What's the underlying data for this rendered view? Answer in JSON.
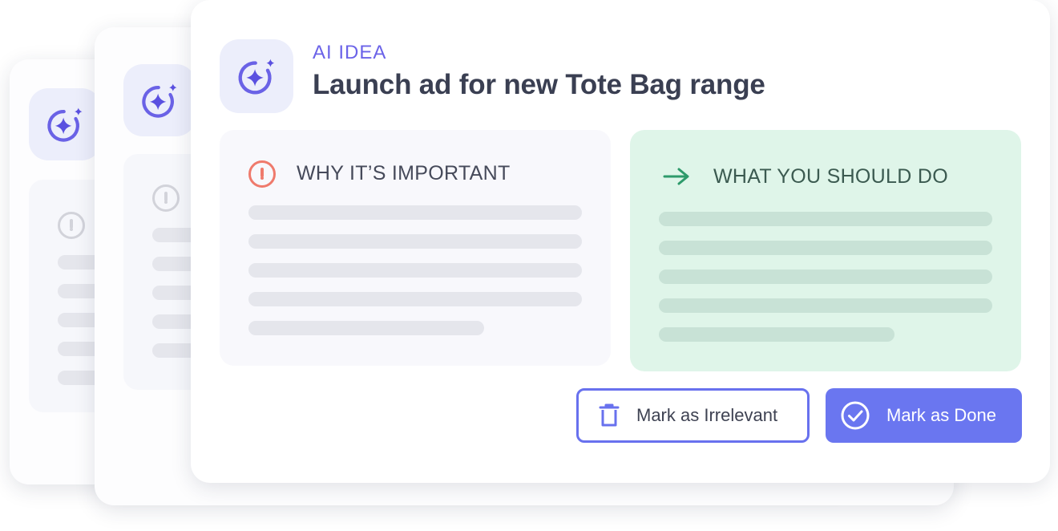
{
  "idea_card": {
    "eyebrow": "AI IDEA",
    "title": "Launch ad for new Tote Bag range",
    "why_section": {
      "heading": "WHY IT’S IMPORTANT",
      "icon": "exclamation-circle-icon"
    },
    "what_section": {
      "heading": "WHAT YOU SHOULD DO",
      "icon": "arrow-right-icon"
    },
    "actions": {
      "irrelevant_label": "Mark as Irrelevant",
      "done_label": "Mark as Done"
    }
  },
  "colors": {
    "accent": "#6a76f0",
    "eyebrow": "#6b63e8",
    "title": "#3a3f52",
    "warning": "#ef7a6c",
    "action_panel": "#dff5e9",
    "arrow": "#2e9a6b"
  },
  "icons": {
    "ai_badge": "sparkle-ai-icon",
    "delete": "trash-icon",
    "done": "check-circle-icon"
  }
}
